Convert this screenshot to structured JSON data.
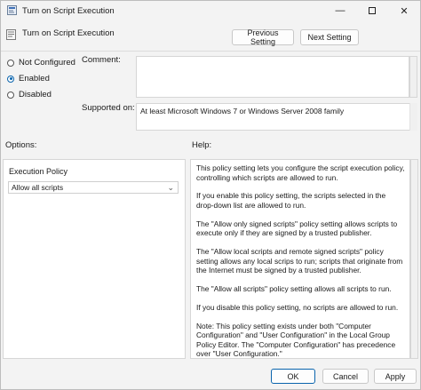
{
  "window": {
    "title": "Turn on Script Execution",
    "minimize_glyph": "—",
    "close_glyph": "✕"
  },
  "header": {
    "policy_name": "Turn on Script Execution",
    "previous_label": "Previous Setting",
    "next_label": "Next Setting"
  },
  "state": {
    "options": [
      {
        "label": "Not Configured",
        "checked": false
      },
      {
        "label": "Enabled",
        "checked": true
      },
      {
        "label": "Disabled",
        "checked": false
      }
    ]
  },
  "fields": {
    "comment_label": "Comment:",
    "comment_value": "",
    "supported_label": "Supported on:",
    "supported_value": "At least Microsoft Windows 7 or Windows Server 2008 family"
  },
  "options_panel": {
    "heading": "Options:",
    "execution_policy_label": "Execution Policy",
    "execution_policy_value": "Allow all scripts"
  },
  "help_panel": {
    "heading": "Help:",
    "paragraphs": [
      "This policy setting lets you configure the script execution policy, controlling which scripts are allowed to run.",
      "If you enable this policy setting, the scripts selected in the drop-down list are allowed to run.",
      "The \"Allow only signed scripts\" policy setting allows scripts to execute only if they are signed by a trusted publisher.",
      "The \"Allow local scripts and remote signed scripts\" policy setting allows any local scrips to run; scripts that originate from the Internet must be signed by a trusted publisher.",
      "The \"Allow all scripts\" policy setting allows all scripts to run.",
      "If you disable this policy setting, no scripts are allowed to run.",
      "Note: This policy setting exists under both \"Computer Configuration\" and \"User Configuration\" in the Local Group Policy Editor. The \"Computer Configuration\" has precedence over \"User Configuration.\""
    ]
  },
  "footer": {
    "ok_label": "OK",
    "cancel_label": "Cancel",
    "apply_label": "Apply"
  },
  "colors": {
    "accent": "#0a64ad",
    "background": "#f3f3f3"
  }
}
